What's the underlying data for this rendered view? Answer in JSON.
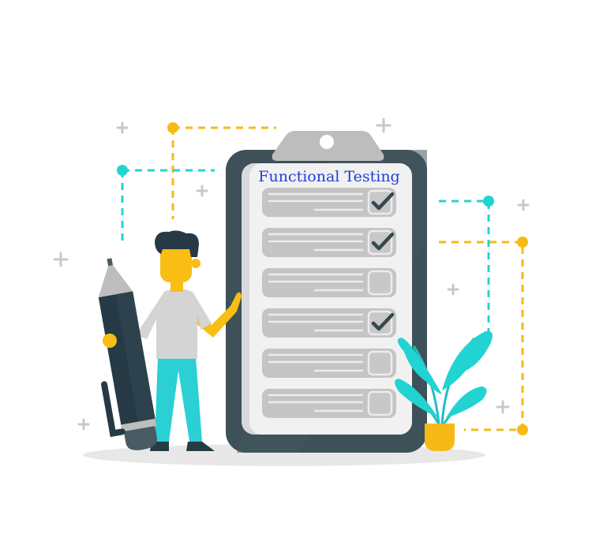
{
  "illustration": {
    "title": "Functional Testing",
    "checklist": [
      {
        "checked": true
      },
      {
        "checked": true
      },
      {
        "checked": false
      },
      {
        "checked": true
      },
      {
        "checked": false
      },
      {
        "checked": false
      }
    ]
  },
  "colors": {
    "title_blue": "#1f3fd6",
    "clipboard_dark": "#3e5058",
    "paper": "#f1f1f1",
    "row_gray": "#c4c4c4",
    "check_dark": "#35474f",
    "accent_yellow": "#f7b916",
    "accent_teal": "#22d3d3",
    "skin_yellow": "#f9bd14",
    "hair_dark": "#263a45",
    "shirt_gray": "#d4d4d4",
    "pants_teal": "#2ad0d4",
    "plus_gray": "#c8c8c8",
    "shadow_gray": "#e6e6e6"
  }
}
